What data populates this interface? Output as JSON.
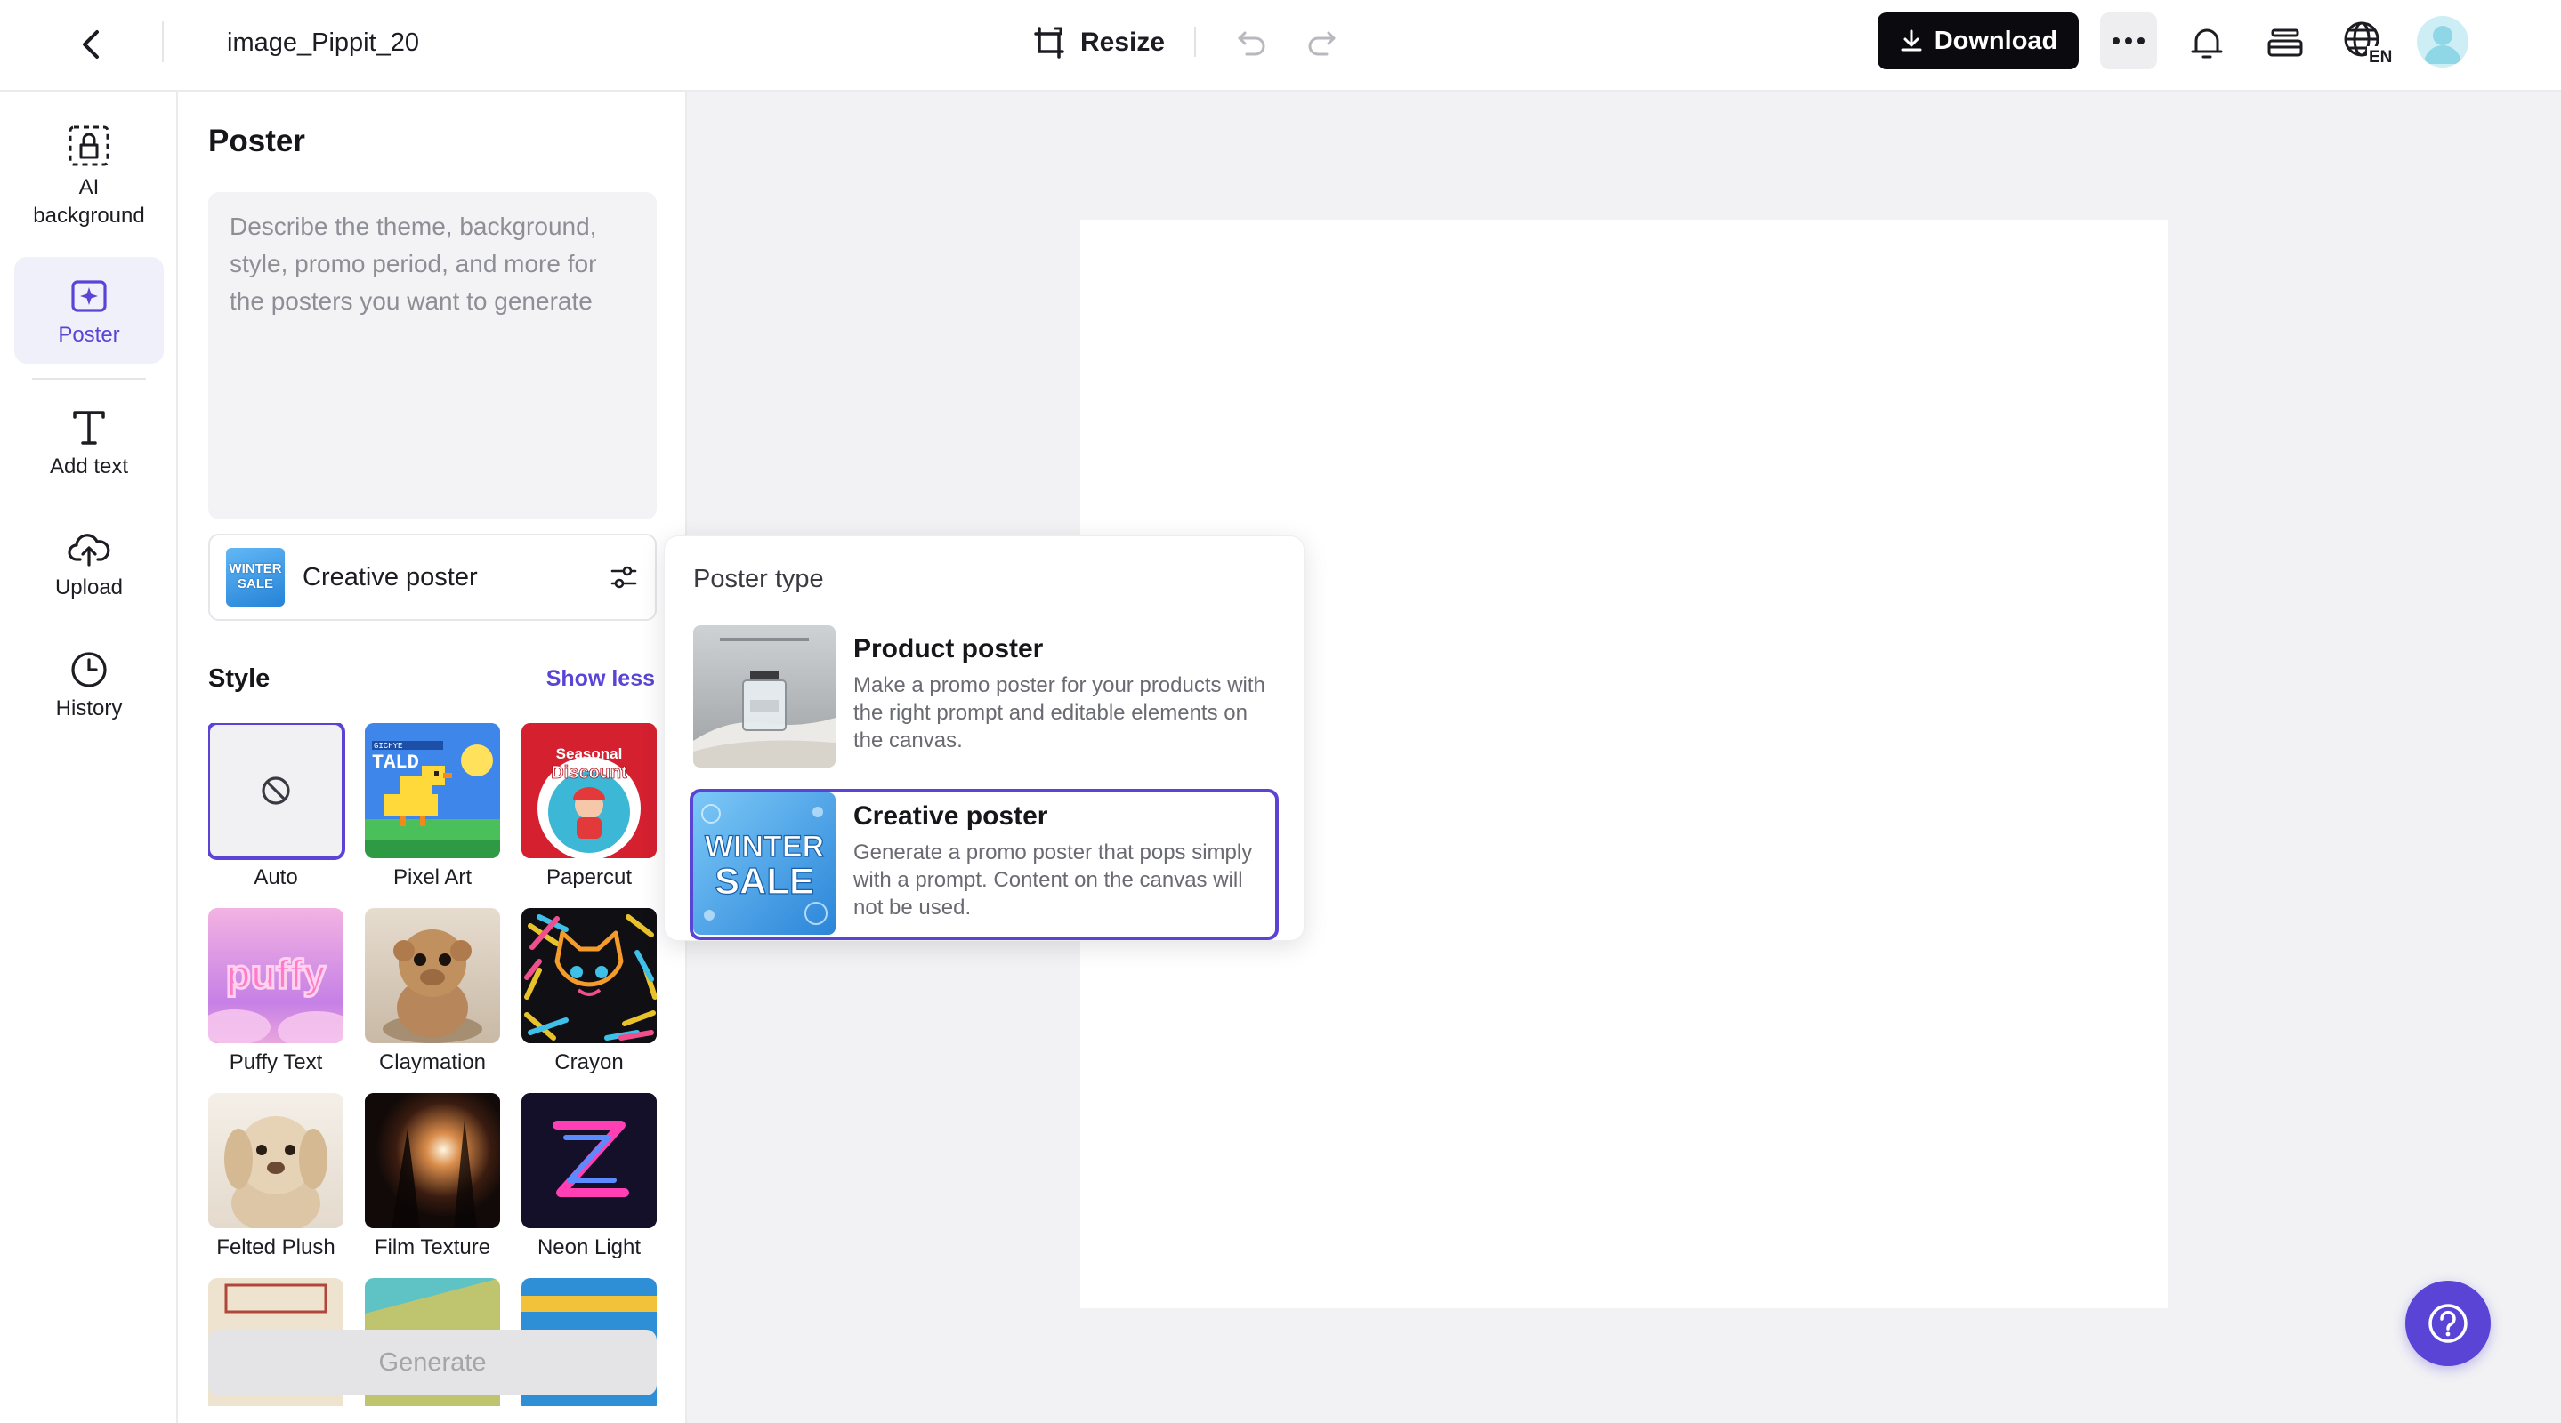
{
  "header": {
    "file_name": "image_Pippit_20",
    "resize_label": "Resize",
    "download_label": "Download",
    "language_code": "EN"
  },
  "rail": {
    "items": [
      {
        "label": "AI background",
        "icon": "ai-background-icon"
      },
      {
        "label": "Poster",
        "icon": "poster-icon",
        "active": true
      },
      {
        "label": "Add text",
        "icon": "text-icon"
      },
      {
        "label": "Upload",
        "icon": "cloud-upload-icon"
      },
      {
        "label": "History",
        "icon": "clock-icon"
      }
    ]
  },
  "panel": {
    "title": "Poster",
    "prompt_placeholder": "Describe the theme, background, style, promo period, and more for the posters you want to generate",
    "prompt_value": "",
    "poster_type_selected": "Creative poster",
    "style_title": "Style",
    "show_less_label": "Show less",
    "styles": [
      {
        "label": "Auto",
        "selected": true
      },
      {
        "label": "Pixel Art"
      },
      {
        "label": "Papercut"
      },
      {
        "label": "Puffy Text"
      },
      {
        "label": "Claymation"
      },
      {
        "label": "Crayon"
      },
      {
        "label": "Felted Plush"
      },
      {
        "label": "Film Texture"
      },
      {
        "label": "Neon Light"
      }
    ],
    "thumb_text": {
      "pixel_top": "GICHYE",
      "pixel_word": "TALD",
      "papercut_line1": "Seasonal",
      "papercut_line2": "Discount",
      "puffy_word": "puffy",
      "winter": "WINTER",
      "sale": "SALE"
    },
    "generate_label": "Generate"
  },
  "popup": {
    "title": "Poster type",
    "options": [
      {
        "name": "Product poster",
        "desc": "Make a promo poster for your products with the right prompt and editable elements on the canvas."
      },
      {
        "name": "Creative poster",
        "desc": "Generate a promo poster that pops simply with a prompt. Content on the canvas will not be used.",
        "selected": true
      }
    ]
  },
  "colors": {
    "accent": "#5a44d6",
    "download_bg": "#0b0b0f",
    "canvas_bg": "#f2f2f4"
  }
}
